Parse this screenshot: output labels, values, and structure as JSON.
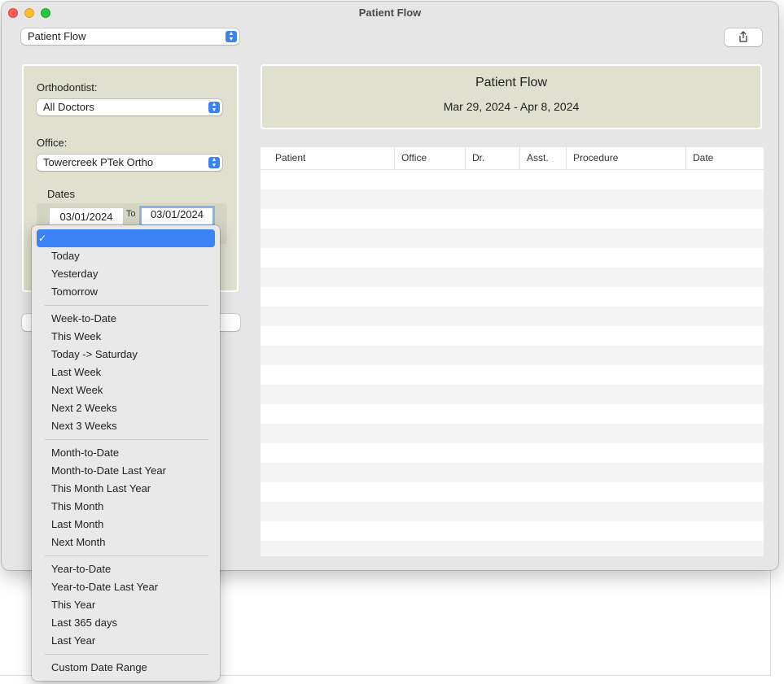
{
  "window": {
    "title": "Patient Flow"
  },
  "toolbar": {
    "report_select": "Patient Flow",
    "share_icon": "share-icon"
  },
  "filters": {
    "orthodontist_label": "Orthodontist:",
    "orthodontist_value": "All Doctors",
    "office_label": "Office:",
    "office_value": "Towercreek PTek Ortho",
    "dates_label": "Dates",
    "date_from": "03/01/2024",
    "to_label": "To",
    "date_to": "03/01/2024"
  },
  "header": {
    "title": "Patient Flow",
    "range": "Mar 29, 2024 - Apr 8, 2024"
  },
  "table": {
    "columns": [
      "Patient",
      "Office",
      "Dr.",
      "Asst.",
      "Procedure",
      "Date"
    ]
  },
  "menu": {
    "selected_check": "✓",
    "items": [
      "Today",
      "Yesterday",
      "Tomorrow",
      "Week-to-Date",
      "This Week",
      "Today -> Saturday",
      "Last Week",
      "Next Week",
      "Next 2 Weeks",
      "Next 3 Weeks",
      "Month-to-Date",
      "Month-to-Date Last Year",
      "This Month Last Year",
      "This Month",
      "Last Month",
      "Next Month",
      "Year-to-Date",
      "Year-to-Date Last Year",
      "This Year",
      "Last 365 days",
      "Last Year",
      "Custom Date Range"
    ]
  },
  "colors": {
    "accent": "#3b82f6",
    "panel": "#dfe0cd"
  }
}
